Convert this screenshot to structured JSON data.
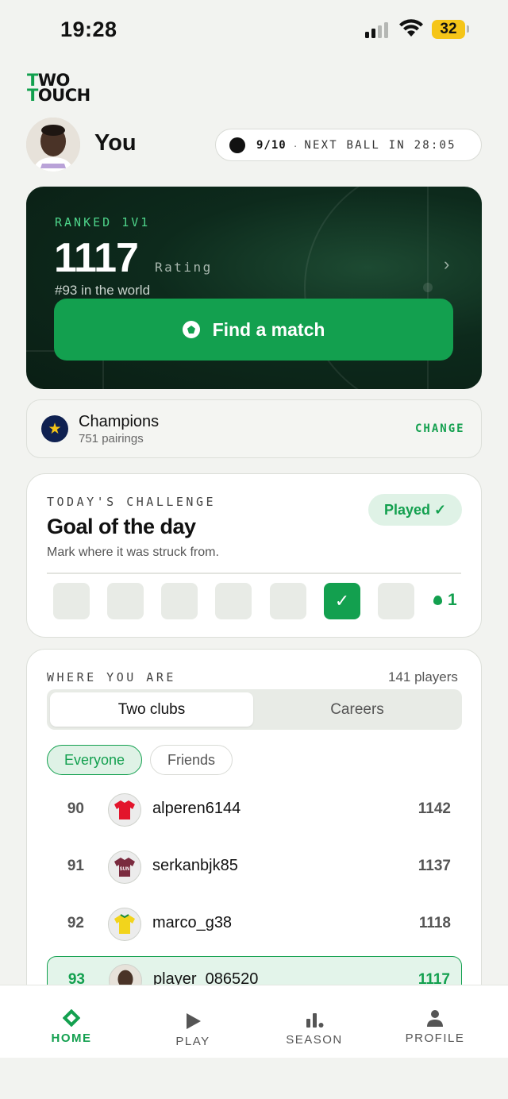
{
  "status_bar": {
    "time": "19:28",
    "battery": "32"
  },
  "logo": {
    "line1_accent": "T",
    "line1_rest": "WO",
    "line2_accent": "T",
    "line2_rest": "OUCH"
  },
  "profile": {
    "name": "You"
  },
  "balls": {
    "count": "9/10",
    "separator": "·",
    "next_ball": "NEXT BALL IN 28:05"
  },
  "ranked": {
    "label": "RANKED 1V1",
    "rating": "1117",
    "rating_label": "Rating",
    "world_rank": "#93 in the world",
    "chevron": "›",
    "cta": "Find a match"
  },
  "league": {
    "name": "Champions",
    "pairings": "751 pairings",
    "action": "CHANGE"
  },
  "challenge": {
    "kicker": "TODAY'S CHALLENGE",
    "title": "Goal of the day",
    "description": "Mark where it was struck from.",
    "status": "Played ✓",
    "days_check": "✓",
    "days": [
      false,
      false,
      false,
      false,
      false,
      true,
      false
    ],
    "streak": "1"
  },
  "leaderboard": {
    "kicker": "WHERE YOU ARE",
    "players": "141 players",
    "tabs": [
      "Two clubs",
      "Careers"
    ],
    "filters": [
      "Everyone",
      "Friends"
    ],
    "rows": [
      {
        "rank": "90",
        "user": "alperen6144",
        "score": "1142",
        "jersey": "#e3142b",
        "jersey_text": ""
      },
      {
        "rank": "91",
        "user": "serkanbjk85",
        "score": "1137",
        "jersey": "#7a2b3f",
        "jersey_text": "SUN"
      },
      {
        "rank": "92",
        "user": "marco_g38",
        "score": "1118",
        "jersey": "#f2d41c",
        "jersey_text": ""
      },
      {
        "rank": "93",
        "user": "player_086520",
        "score": "1117",
        "jersey": "photo",
        "jersey_text": ""
      }
    ]
  },
  "tabbar": {
    "items": [
      "HOME",
      "PLAY",
      "SEASON",
      "PROFILE"
    ],
    "active": "HOME"
  },
  "colors": {
    "accent": "#13a04f",
    "dark_card": "#0d2a1c",
    "badge_blue": "#0f2151",
    "battery": "#f5c518"
  }
}
